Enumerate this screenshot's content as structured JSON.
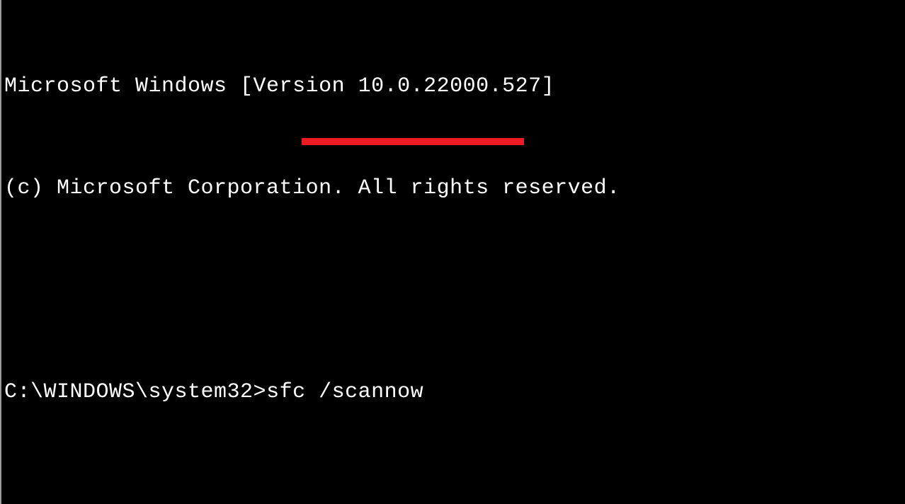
{
  "terminal": {
    "version_line": "Microsoft Windows [Version 10.0.22000.527]",
    "copyright_line": "(c) Microsoft Corporation. All rights reserved.",
    "prompt": "C:\\WINDOWS\\system32>",
    "command": "sfc /scannow"
  },
  "annotation": {
    "underline_color": "#ed1c24"
  }
}
